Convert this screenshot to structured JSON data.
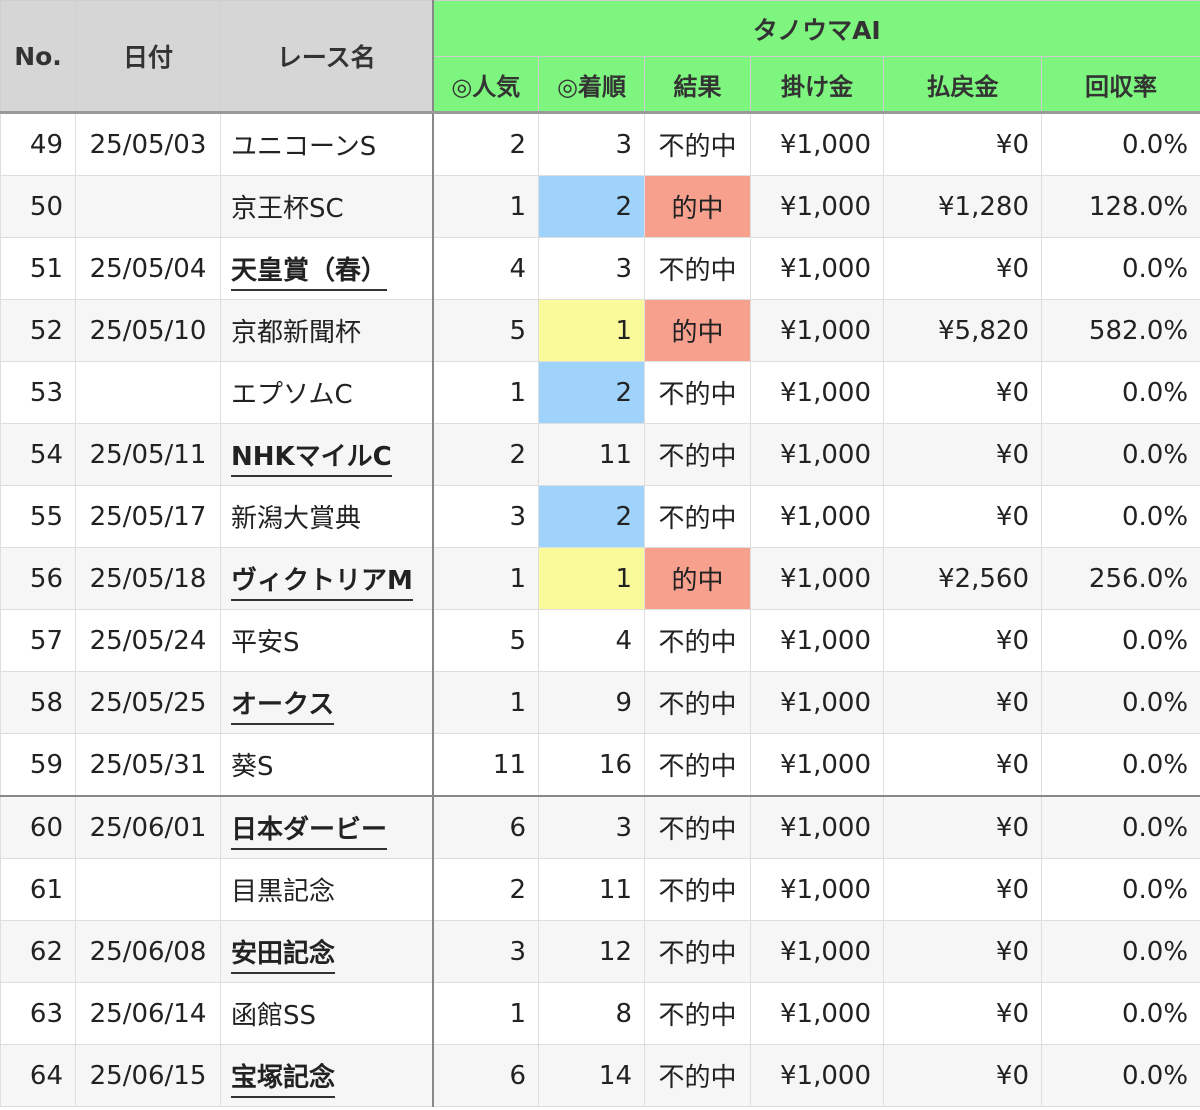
{
  "header": {
    "no": "No.",
    "date": "日付",
    "race": "レース名",
    "group": "タノウマAI",
    "popularity": "◎人気",
    "finish": "◎着順",
    "result": "結果",
    "bet": "掛け金",
    "payout": "払戻金",
    "rate": "回収率"
  },
  "colors": {
    "header_gray": "#d6d6d6",
    "header_green": "#7ef57e",
    "highlight_blue": "#9fd3fb",
    "highlight_yellow": "#fbfa9b",
    "highlight_red": "#f8a08e"
  },
  "rows": [
    {
      "no": "49",
      "date": "25/05/03",
      "race": "ユニコーンS",
      "g1": false,
      "pop": "2",
      "fin": "3",
      "result": "不的中",
      "bet": "¥1,000",
      "payout": "¥0",
      "rate": "0.0%"
    },
    {
      "no": "50",
      "date": "",
      "race": "京王杯SC",
      "g1": false,
      "pop": "1",
      "fin": "2",
      "result": "的中",
      "bet": "¥1,000",
      "payout": "¥1,280",
      "rate": "128.0%"
    },
    {
      "no": "51",
      "date": "25/05/04",
      "race": "天皇賞（春）",
      "g1": true,
      "pop": "4",
      "fin": "3",
      "result": "不的中",
      "bet": "¥1,000",
      "payout": "¥0",
      "rate": "0.0%"
    },
    {
      "no": "52",
      "date": "25/05/10",
      "race": "京都新聞杯",
      "g1": false,
      "pop": "5",
      "fin": "1",
      "result": "的中",
      "bet": "¥1,000",
      "payout": "¥5,820",
      "rate": "582.0%"
    },
    {
      "no": "53",
      "date": "",
      "race": "エプソムC",
      "g1": false,
      "pop": "1",
      "fin": "2",
      "result": "不的中",
      "bet": "¥1,000",
      "payout": "¥0",
      "rate": "0.0%"
    },
    {
      "no": "54",
      "date": "25/05/11",
      "race": "NHKマイルC",
      "g1": true,
      "pop": "2",
      "fin": "11",
      "result": "不的中",
      "bet": "¥1,000",
      "payout": "¥0",
      "rate": "0.0%"
    },
    {
      "no": "55",
      "date": "25/05/17",
      "race": "新潟大賞典",
      "g1": false,
      "pop": "3",
      "fin": "2",
      "result": "不的中",
      "bet": "¥1,000",
      "payout": "¥0",
      "rate": "0.0%"
    },
    {
      "no": "56",
      "date": "25/05/18",
      "race": "ヴィクトリアM",
      "g1": true,
      "pop": "1",
      "fin": "1",
      "result": "的中",
      "bet": "¥1,000",
      "payout": "¥2,560",
      "rate": "256.0%"
    },
    {
      "no": "57",
      "date": "25/05/24",
      "race": "平安S",
      "g1": false,
      "pop": "5",
      "fin": "4",
      "result": "不的中",
      "bet": "¥1,000",
      "payout": "¥0",
      "rate": "0.0%"
    },
    {
      "no": "58",
      "date": "25/05/25",
      "race": "オークス",
      "g1": true,
      "pop": "1",
      "fin": "9",
      "result": "不的中",
      "bet": "¥1,000",
      "payout": "¥0",
      "rate": "0.0%"
    },
    {
      "no": "59",
      "date": "25/05/31",
      "race": "葵S",
      "g1": false,
      "pop": "11",
      "fin": "16",
      "result": "不的中",
      "bet": "¥1,000",
      "payout": "¥0",
      "rate": "0.0%"
    },
    {
      "no": "60",
      "date": "25/06/01",
      "race": "日本ダービー",
      "g1": true,
      "pop": "6",
      "fin": "3",
      "result": "不的中",
      "bet": "¥1,000",
      "payout": "¥0",
      "rate": "0.0%"
    },
    {
      "no": "61",
      "date": "",
      "race": "目黒記念",
      "g1": false,
      "pop": "2",
      "fin": "11",
      "result": "不的中",
      "bet": "¥1,000",
      "payout": "¥0",
      "rate": "0.0%"
    },
    {
      "no": "62",
      "date": "25/06/08",
      "race": "安田記念",
      "g1": true,
      "pop": "3",
      "fin": "12",
      "result": "不的中",
      "bet": "¥1,000",
      "payout": "¥0",
      "rate": "0.0%"
    },
    {
      "no": "63",
      "date": "25/06/14",
      "race": "函館SS",
      "g1": false,
      "pop": "1",
      "fin": "8",
      "result": "不的中",
      "bet": "¥1,000",
      "payout": "¥0",
      "rate": "0.0%"
    },
    {
      "no": "64",
      "date": "25/06/15",
      "race": "宝塚記念",
      "g1": true,
      "pop": "6",
      "fin": "14",
      "result": "不的中",
      "bet": "¥1,000",
      "payout": "¥0",
      "rate": "0.0%"
    }
  ]
}
